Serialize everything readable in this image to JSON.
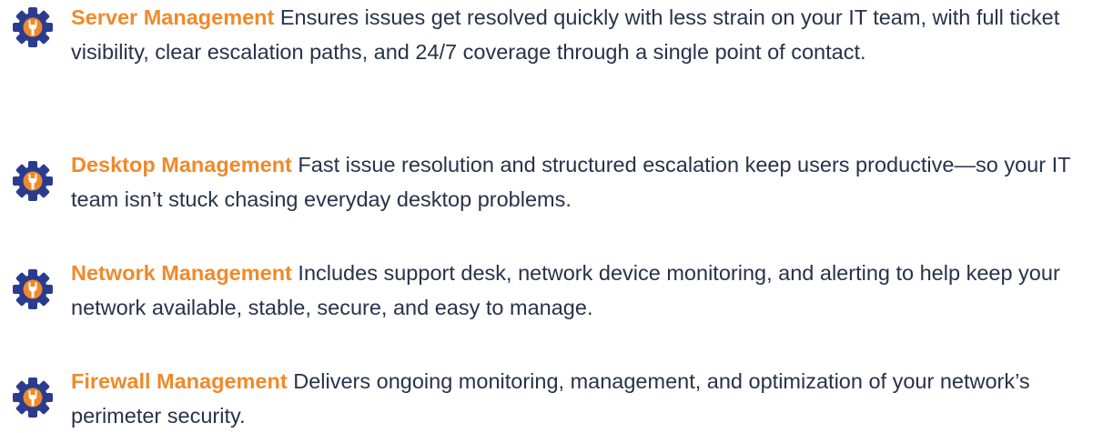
{
  "colors": {
    "accent": "#ef8a2a",
    "icon_blue": "#2b3c8f",
    "body_text": "#27324a"
  },
  "items": [
    {
      "icon": "gear-wrench-icon",
      "title": "Server Management",
      "description": "Ensures issues get resolved quickly with less strain on your IT team, with full ticket visibility, clear escalation paths, and 24/7 coverage through a single point of contact."
    },
    {
      "icon": "gear-wrench-icon",
      "title": "Desktop Management",
      "description": "Fast issue resolution and structured escalation keep users productive—so your IT team isn’t stuck chasing everyday desktop problems."
    },
    {
      "icon": "gear-wrench-icon",
      "title": "Network Management",
      "description": "Includes support desk, network device monitoring, and alerting to help keep your network available, stable, secure, and easy to manage."
    },
    {
      "icon": "gear-wrench-icon",
      "title": "Firewall Management",
      "description": "Delivers ongoing monitoring, management, and optimization of your network’s perimeter security."
    }
  ]
}
